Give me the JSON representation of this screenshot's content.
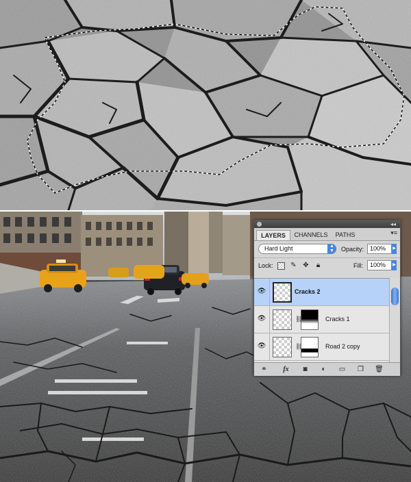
{
  "panel": {
    "tabs": [
      {
        "label": "LAYERS",
        "active": true
      },
      {
        "label": "CHANNELS",
        "active": false
      },
      {
        "label": "PATHS",
        "active": false
      }
    ],
    "menu_glyph": "▾≡",
    "blend_mode": "Hard Light",
    "opacity_label": "Opacity:",
    "opacity_value": "100%",
    "lock_label": "Lock:",
    "fill_label": "Fill:",
    "fill_value": "100%",
    "layers": [
      {
        "name": "Cracks 2",
        "selected": true,
        "visible": true,
        "has_mask": false
      },
      {
        "name": "Cracks 1",
        "selected": false,
        "visible": true,
        "has_mask": true
      },
      {
        "name": "Road 2 copy",
        "selected": false,
        "visible": true,
        "has_mask": true
      }
    ],
    "footer_icons": [
      "link-icon",
      "fx-icon",
      "add-mask-icon",
      "adjustment-layer-icon",
      "new-group-icon",
      "new-layer-icon",
      "trash-icon"
    ],
    "accent_color": "#4a86d8",
    "selected_row_color": "#b6d2f8"
  }
}
